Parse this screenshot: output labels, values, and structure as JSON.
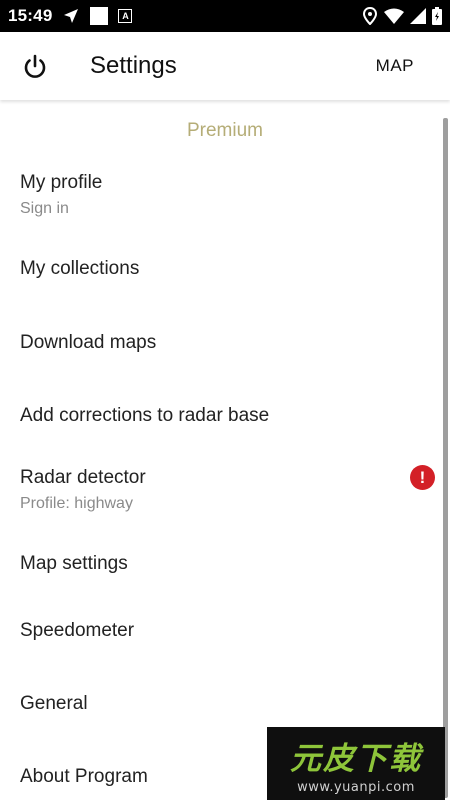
{
  "status_bar": {
    "time": "15:49",
    "icons_left": [
      "navigation-arrow-icon",
      "notification-square-icon",
      "a-box-icon"
    ],
    "icons_right": [
      "location-pin-icon",
      "wifi-icon",
      "signal-icon",
      "battery-icon"
    ]
  },
  "app_bar": {
    "title": "Settings",
    "map_label": "MAP"
  },
  "premium_label": "Premium",
  "menu": [
    {
      "title": "My profile",
      "subtitle": "Sign in"
    },
    {
      "title": "My collections"
    },
    {
      "title": "Download maps"
    },
    {
      "title": "Add corrections to radar base"
    },
    {
      "title": "Radar detector",
      "subtitle": "Profile: highway",
      "alert": "!"
    },
    {
      "title": "Map settings"
    },
    {
      "title": "Speedometer"
    },
    {
      "title": "General"
    },
    {
      "title": "About Program"
    }
  ],
  "watermark": {
    "cn": "元皮下载",
    "url": "www.yuanpi.com"
  },
  "colors": {
    "premium": "#b5ad77",
    "alert": "#d32027",
    "watermark_green": "#8ec53a"
  }
}
